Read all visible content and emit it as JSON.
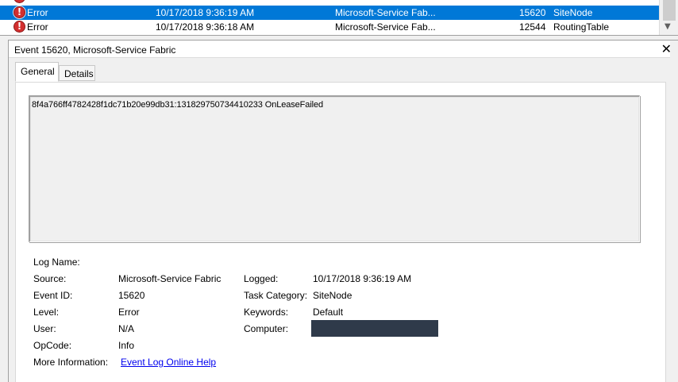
{
  "event_list": {
    "rows": [
      {
        "level": "Error",
        "date": "10/17/2018 9:36:19 AM",
        "source": "Microsoft-Service Fab...",
        "event_id": "15620",
        "category": "SiteNode"
      },
      {
        "level": "Error",
        "date": "10/17/2018 9:36:18 AM",
        "source": "Microsoft-Service Fab...",
        "event_id": "12544",
        "category": "RoutingTable"
      }
    ]
  },
  "pane": {
    "title": "Event 15620, Microsoft-Service Fabric",
    "close_glyph": "✕"
  },
  "tabs": [
    {
      "label": "General"
    },
    {
      "label": "Details"
    }
  ],
  "description": "8f4a766ff4782428f1dc71b20e99db31:131829750734410233 OnLeaseFailed",
  "props": {
    "log_name_label": "Log Name:",
    "log_name_value": "",
    "source_label": "Source:",
    "source_value": "Microsoft-Service Fabric",
    "logged_label": "Logged:",
    "logged_value": "10/17/2018 9:36:19 AM",
    "event_id_label": "Event ID:",
    "event_id_value": "15620",
    "task_category_label": "Task Category:",
    "task_category_value": "SiteNode",
    "level_label": "Level:",
    "level_value": "Error",
    "keywords_label": "Keywords:",
    "keywords_value": "Default",
    "user_label": "User:",
    "user_value": "N/A",
    "computer_label": "Computer:",
    "opcode_label": "OpCode:",
    "opcode_value": "Info",
    "more_info_label": "More Information:",
    "more_info_link": "Event Log Online Help"
  },
  "colors": {
    "selection": "#0078d7",
    "error_icon": "#d32f2f",
    "redaction": "#2f3a4a",
    "link": "#0000ee"
  },
  "icons": {
    "row_level": "error-icon",
    "close": "close-icon",
    "scroll_down": "chevron-down-icon"
  }
}
